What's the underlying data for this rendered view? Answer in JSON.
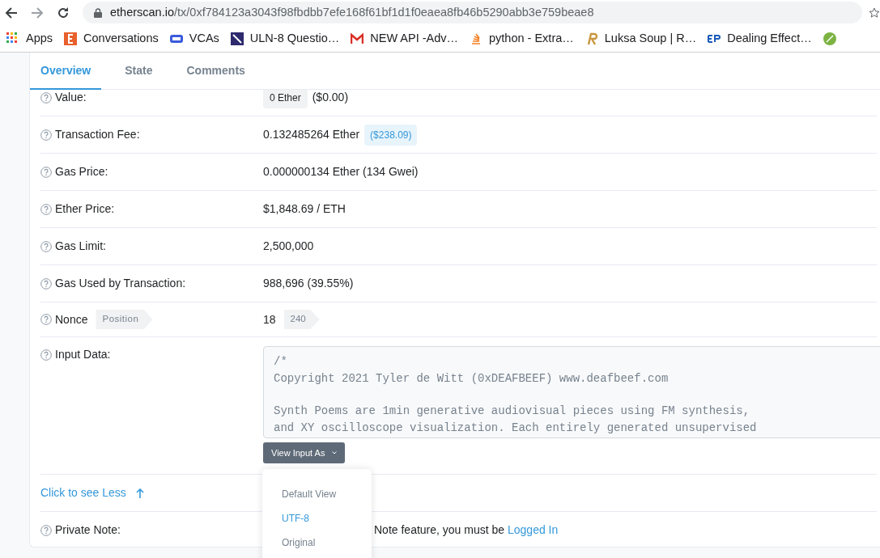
{
  "browser": {
    "url_host": "etherscan.io",
    "url_path": "/tx/0xf784123a3043f98fbdbb7efe168f61bf1d1f0eaea8fb46b5290abb3e759beae8",
    "bookmarks": [
      {
        "label": "Apps"
      },
      {
        "label": "Conversations"
      },
      {
        "label": "VCAs"
      },
      {
        "label": "ULN-8 Questio…"
      },
      {
        "label": "NEW API -Adv…"
      },
      {
        "label": "python - Extra…"
      },
      {
        "label": "Luksa Soup | R…"
      },
      {
        "label": "Dealing Effect…"
      }
    ]
  },
  "tabs": [
    {
      "label": "Overview",
      "selected": true
    },
    {
      "label": "State",
      "selected": false
    },
    {
      "label": "Comments",
      "selected": false
    }
  ],
  "rows": [
    {
      "kind": "value",
      "label": "Value:",
      "badge": "0 Ether",
      "value": "($0.00)"
    },
    {
      "kind": "fee",
      "label": "Transaction Fee:",
      "value": "0.132485264 Ether",
      "badge": "($238.09)"
    },
    {
      "kind": "text",
      "label": "Gas Price:",
      "value": "0.000000134 Ether (134 Gwei)"
    },
    {
      "kind": "text",
      "label": "Ether Price:",
      "value": "$1,848.69 / ETH"
    },
    {
      "kind": "text",
      "label": "Gas Limit:",
      "value": "2,500,000"
    },
    {
      "kind": "text",
      "label": "Gas Used by Transaction:",
      "value": "988,696 (39.55%)"
    },
    {
      "kind": "nonce",
      "label": "Nonce",
      "tag": "Position",
      "value": "18",
      "badge": "240"
    },
    {
      "kind": "input",
      "label": "Input Data:",
      "code_paragraphs": [
        [
          "/*",
          "Copyright 2021 Tyler de Witt (0xDEAFBEEF) www.deafbeef.com"
        ],
        [
          "Synth Poems are 1min generative audiovisual pieces using FM synthesis,",
          "and XY oscilloscope visualization. Each entirely generated unsupervised"
        ]
      ],
      "button": "View Input As",
      "options": [
        {
          "label": "Default View",
          "selected": false
        },
        {
          "label": "UTF-8",
          "selected": true
        },
        {
          "label": "Original",
          "selected": false
        }
      ]
    },
    {
      "kind": "toggle",
      "label": "Click to see Less"
    },
    {
      "kind": "note",
      "label": "Private Note:",
      "value": "Note feature, you must be",
      "link": "Logged In"
    }
  ]
}
